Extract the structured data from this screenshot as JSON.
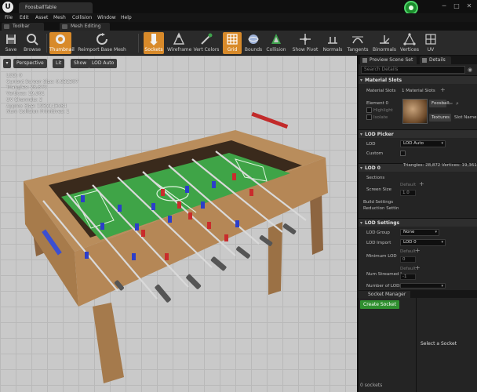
{
  "window": {
    "doc_tab": "FoosballTable",
    "minimize": "─",
    "maximize": "□",
    "close": "✕"
  },
  "menu": [
    "File",
    "Edit",
    "Asset",
    "Mesh",
    "Collision",
    "Window",
    "Help"
  ],
  "panel_tabs": [
    "Toolbar",
    "Mesh Editing"
  ],
  "toolbar": [
    {
      "label": "Save",
      "icon": "save-icon"
    },
    {
      "label": "Browse",
      "icon": "browse-icon"
    },
    {
      "label": "Thumbnail",
      "icon": "thumbnail-icon"
    },
    {
      "label": "Reimport Base Mesh",
      "icon": "reimport-icon"
    },
    {
      "label": "Sockets",
      "icon": "sockets-icon"
    },
    {
      "label": "Wireframe",
      "icon": "wireframe-icon"
    },
    {
      "label": "Vert Colors",
      "icon": "vert-colors-icon"
    },
    {
      "label": "Grid",
      "icon": "grid-icon"
    },
    {
      "label": "Bounds",
      "icon": "bounds-icon"
    },
    {
      "label": "Collision",
      "icon": "collision-icon"
    },
    {
      "label": "Show Pivot",
      "icon": "show-pivot-icon"
    },
    {
      "label": "Normals",
      "icon": "normals-icon"
    },
    {
      "label": "Tangents",
      "icon": "tangents-icon"
    },
    {
      "label": "Binormals",
      "icon": "binormals-icon"
    },
    {
      "label": "Vertices",
      "icon": "vertices-icon"
    },
    {
      "label": "UV",
      "icon": "uv-icon"
    }
  ],
  "viewport": {
    "perspective": "Perspective",
    "lit": "Lit",
    "show": "Show",
    "lod": "LOD Auto",
    "stats": [
      "LOD: 0",
      "Current Screen Size: 0.932307",
      "Triangles: 28,872",
      "Vertices: 19,361",
      "UV Channels: 2",
      "Approx Size: 193x143x84",
      "Num Collision Primitives: 1"
    ]
  },
  "right_panel": {
    "tabs": [
      "Preview Scene Set",
      "Details"
    ],
    "search_placeholder": "Search Details",
    "material_slots": {
      "header": "Material Slots",
      "label": "Material Slots",
      "count": "1 Material Slots",
      "element": "Element 0",
      "highlight": "Highlight",
      "isolate": "Isolate",
      "material_name": "Foosball",
      "textures": "Textures",
      "slot_name": "Slot Name"
    },
    "lod_picker": {
      "header": "LOD Picker",
      "lod_label": "LOD",
      "lod_value": "LOD Auto",
      "custom": "Custom"
    },
    "lod0": {
      "header": "LOD 0",
      "triangles": "Triangles: 28,872",
      "vertices": "Vertices: 19,361",
      "sections": "Sections",
      "screen_size": "Screen Size",
      "default": "Default",
      "screen_value": "1.0",
      "build_settings": "Build Settings",
      "reduction_settings": "Reduction Settin"
    },
    "lod_settings": {
      "header": "LOD Settings",
      "lod_group": "LOD Group",
      "lod_group_value": "None",
      "lod_import": "LOD Import",
      "lod_import_value": "LOD 0",
      "minimum_lod": "Minimum LOD",
      "default": "Default",
      "min_value": "0",
      "num_streamed": "Num Streamed L",
      "num_value": "-1",
      "number_of_lods": "Number of LODs"
    }
  },
  "socket_manager": {
    "tab": "Socket Manager",
    "create": "Create Socket",
    "select": "Select a Socket",
    "count": "0 sockets"
  }
}
